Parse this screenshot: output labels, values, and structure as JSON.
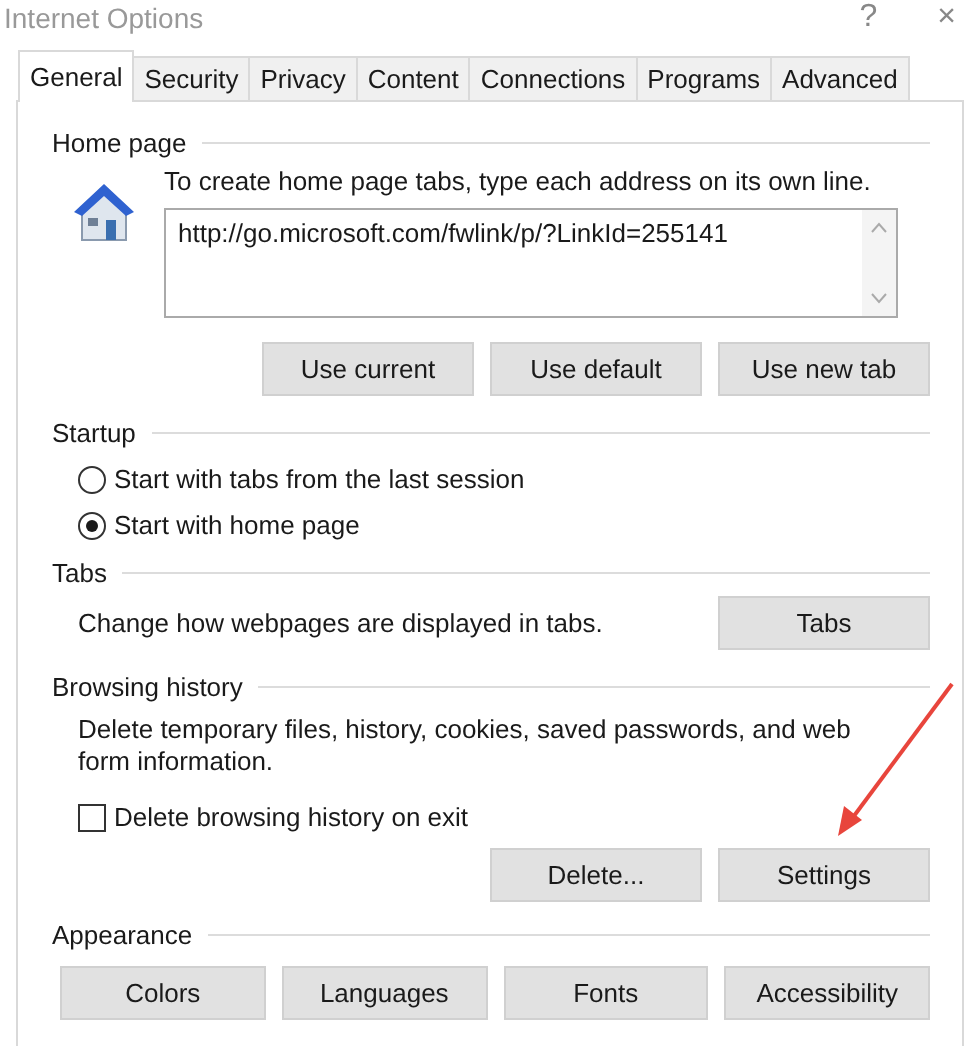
{
  "window": {
    "title": "Internet Options",
    "buttons": [
      "?",
      "×"
    ]
  },
  "tabs": [
    {
      "label": "General",
      "selected": true
    },
    {
      "label": "Security",
      "selected": false
    },
    {
      "label": "Privacy",
      "selected": false
    },
    {
      "label": "Content",
      "selected": false
    },
    {
      "label": "Connections",
      "selected": false
    },
    {
      "label": "Programs",
      "selected": false
    },
    {
      "label": "Advanced",
      "selected": false
    }
  ],
  "home_page": {
    "heading": "Home page",
    "instruction": "To create home page tabs, type each address on its own line.",
    "address": "http://go.microsoft.com/fwlink/p/?LinkId=255141",
    "buttons": [
      "Use current",
      "Use default",
      "Use new tab"
    ]
  },
  "startup": {
    "heading": "Startup",
    "options": [
      {
        "label": "Start with tabs from the last session",
        "selected": false
      },
      {
        "label": "Start with home page",
        "selected": true
      }
    ]
  },
  "tabs_section": {
    "heading": "Tabs",
    "description": "Change how webpages are displayed in tabs.",
    "button": "Tabs"
  },
  "browsing_history": {
    "heading": "Browsing history",
    "description": "Delete temporary files, history, cookies, saved passwords, and web form information.",
    "checkbox": {
      "label": "Delete browsing history on exit",
      "checked": false
    },
    "buttons": [
      "Delete...",
      "Settings"
    ]
  },
  "appearance": {
    "heading": "Appearance",
    "buttons": [
      "Colors",
      "Languages",
      "Fonts",
      "Accessibility"
    ]
  }
}
